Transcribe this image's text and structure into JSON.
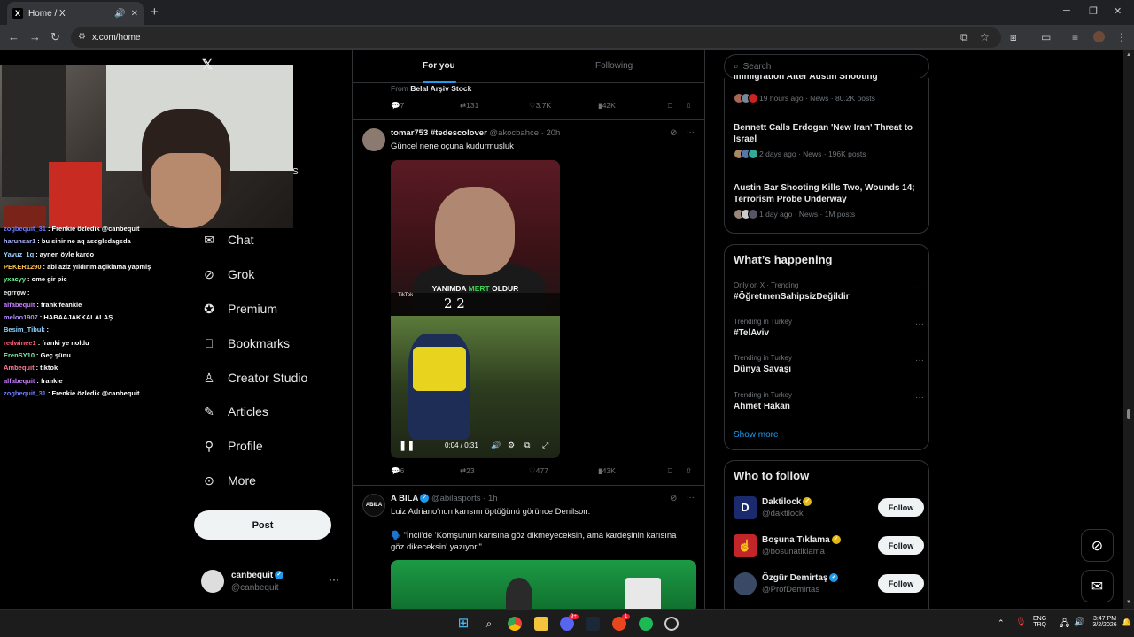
{
  "browser": {
    "tab_title": "Home / X",
    "url": "x.com/home"
  },
  "stream_overlay": {
    "webcam_suffix": "S",
    "chat": [
      {
        "user": "zogbequit_31",
        "msg": ": Frenkie özledik @canbequit",
        "color": "#6e7bff"
      },
      {
        "user": "harunsar1",
        "msg": ": bu sinir ne aq asdglsdagsda",
        "color": "#b0b7ff"
      },
      {
        "user": "Yavuz_1q",
        "msg": ": aynen öyle kardo",
        "color": "#9bd0ff"
      },
      {
        "user": "PEKER1290",
        "msg": ": abi aziz yıldırım açiklama yapmiş",
        "color": "#ffc54d"
      },
      {
        "user": "yxacyy",
        "msg": ": ome gir pic",
        "color": "#6fff9c"
      },
      {
        "user": "egrrgw",
        "msg": ":",
        "color": "#e7e9ea"
      },
      {
        "user": "alfabequit",
        "msg": ": frank feankie",
        "color": "#c77dff"
      },
      {
        "user": "meloo1907",
        "msg": ": HABAAJAKKALALAŞ",
        "color": "#b18cff"
      },
      {
        "user": "Besim_Tibuk",
        "msg": ":",
        "color": "#8fd3ff"
      },
      {
        "user": "redwinee1",
        "msg": ": franki ye noldu",
        "color": "#ff5b74"
      },
      {
        "user": "ErenSY10",
        "msg": ": Geç şünu",
        "color": "#7cf0a5"
      },
      {
        "user": "Ambequit",
        "msg": ": tiktok",
        "color": "#ff7b95"
      },
      {
        "user": "alfabequit",
        "msg": ": frankie",
        "color": "#c77dff"
      },
      {
        "user": "zogbequit_31",
        "msg": ": Frenkie özledik @canbequit",
        "color": "#6e7bff"
      }
    ]
  },
  "nav": {
    "items": [
      {
        "label": "Chat",
        "icon": "mail-icon"
      },
      {
        "label": "Grok",
        "icon": "grok-icon"
      },
      {
        "label": "Premium",
        "icon": "premium-icon"
      },
      {
        "label": "Bookmarks",
        "icon": "bookmark-icon"
      },
      {
        "label": "Creator Studio",
        "icon": "creator-studio-icon"
      },
      {
        "label": "Articles",
        "icon": "articles-icon"
      },
      {
        "label": "Profile",
        "icon": "profile-icon"
      },
      {
        "label": "More",
        "icon": "more-icon"
      }
    ],
    "post_label": "Post",
    "account": {
      "name": "canbequit",
      "handle": "@canbequit"
    }
  },
  "feed": {
    "tabs": [
      "For you",
      "Following"
    ],
    "prev_tweet": {
      "from_label": "From",
      "from_source": "Belal Arşiv Stock",
      "replies": "7",
      "reposts": "131",
      "likes": "3.7K",
      "views": "42K"
    },
    "tweet1": {
      "name": "tomar753 #tedescolover",
      "handle": "@akocbahce",
      "time": "· 20h",
      "text": "Güncel nene oçuna kudurmuşluk",
      "video_caption_a": "YANIMDA",
      "video_caption_b": "MERT",
      "video_caption_c": "OLDUR",
      "video_score": "2 2",
      "video_brand": "TikTok",
      "video_time": "0:04 / 0:31",
      "replies": "6",
      "reposts": "23",
      "likes": "477",
      "views": "43K"
    },
    "tweet2": {
      "name": "A BILA",
      "handle": "@abilasports",
      "time": "· 1h",
      "avatar_text": "ABILA",
      "text1": "Luiz Adriano'nun karısını öptüğünü görünce Denilson:",
      "text2": "🗣️ \"İncil'de 'Komşunun karısına göz dikmeyeceksin, ama kardeşinin karısına göz dikeceksin' yazıyor.\""
    }
  },
  "right": {
    "search_placeholder": "Search",
    "top_fragment": "Immigration After Austin Shooting",
    "news": [
      {
        "title": "",
        "meta": "19 hours ago · News · 80.2K posts"
      },
      {
        "title": "Bennett Calls Erdogan 'New Iran' Threat to Israel",
        "meta": "2 days ago · News · 196K posts"
      },
      {
        "title": "Austin Bar Shooting Kills Two, Wounds 14; Terrorism Probe Underway",
        "meta": "1 day ago · News · 1M posts"
      }
    ],
    "happening_title": "What’s happening",
    "trends": [
      {
        "context": "Only on X · Trending",
        "name": "#ÖğretmenSahipsizDeğildir"
      },
      {
        "context": "Trending in Turkey",
        "name": "#TelAviv"
      },
      {
        "context": "Trending in Turkey",
        "name": "Dünya Savaşı"
      },
      {
        "context": "Trending in Turkey",
        "name": "Ahmet Hakan"
      }
    ],
    "show_more": "Show more",
    "who_title": "Who to follow",
    "who": [
      {
        "name": "Daktilock",
        "handle": "@daktilock",
        "color": "#1a2a6c",
        "glyph": "D"
      },
      {
        "name": "Boşuna Tıklama",
        "handle": "@bosunatiklama",
        "color": "#c2262b",
        "glyph": "☝"
      },
      {
        "name": "Özgür Demirtaş",
        "handle": "@ProfDemirtas",
        "color": "#3a4a66",
        "glyph": ""
      }
    ],
    "follow_label": "Follow"
  },
  "taskbar": {
    "lang1": "ENG",
    "lang2": "TRQ",
    "time": "3:47 PM",
    "date": "3/2/2026",
    "discord_badge": "9+",
    "app_badge": "1"
  }
}
